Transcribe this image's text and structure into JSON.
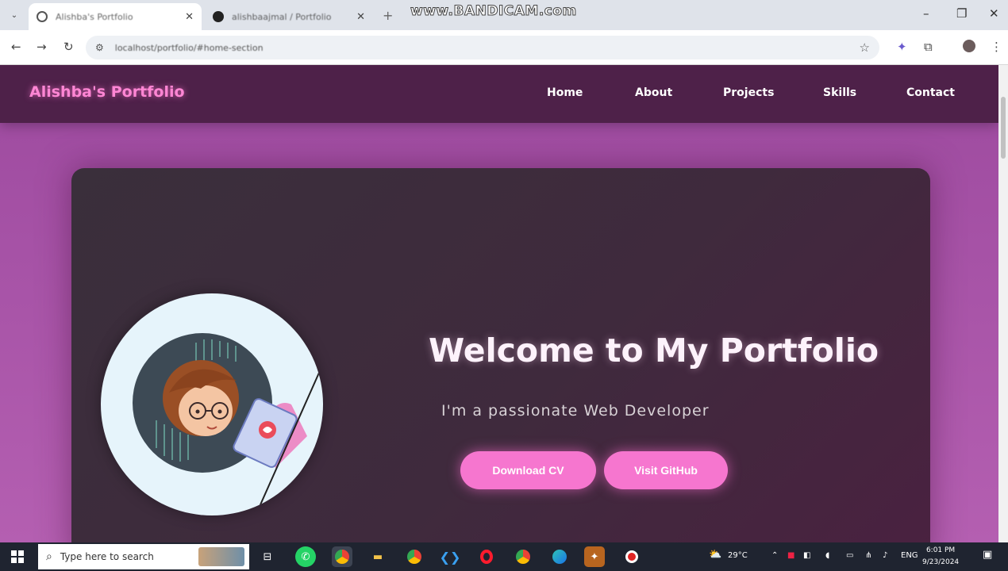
{
  "browser": {
    "tabs": [
      {
        "title": "Alishba's Portfolio",
        "active": true
      },
      {
        "title": "alishbaajmal / Portfolio",
        "active": false
      }
    ],
    "new_tab": "+",
    "watermark": "www.BANDICAM.com",
    "url": "localhost/portfolio/#home-section",
    "window_controls": {
      "minimize": "–",
      "restore": "❐",
      "close": "✕"
    }
  },
  "site": {
    "brand": "Alishba's Portfolio",
    "nav": [
      "Home",
      "About",
      "Projects",
      "Skills",
      "Contact"
    ],
    "hero": {
      "headline": "Welcome to My Portfolio",
      "subline": "I'm a passionate Web Developer",
      "primary_button": "Download CV",
      "secondary_button": "Visit GitHub"
    }
  },
  "taskbar": {
    "search_placeholder": "Type here to search",
    "weather": "29°C",
    "time": "6:01 PM",
    "date": "9/23/2024",
    "lang": "ENG"
  },
  "colors": {
    "accent_pink": "#f676cf",
    "nav_bg": "#4e2149",
    "page_bg": "#a24fa3",
    "hero_bg": "#3a2f3b"
  }
}
